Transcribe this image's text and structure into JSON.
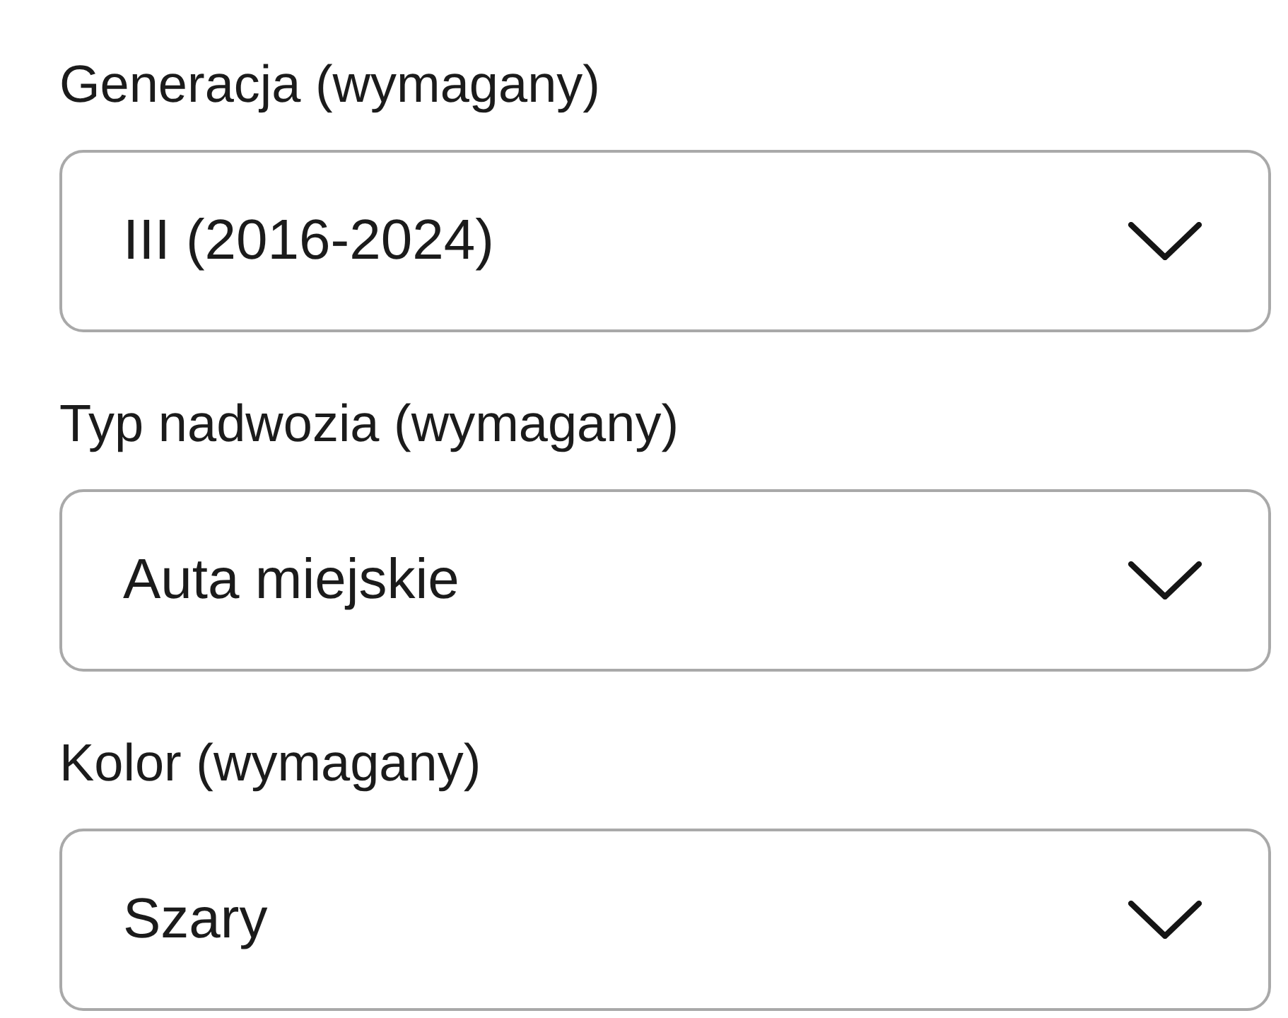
{
  "fields": [
    {
      "label": "Generacja (wymagany)",
      "value": "III (2016-2024)"
    },
    {
      "label": "Typ nadwozia (wymagany)",
      "value": "Auta miejskie"
    },
    {
      "label": "Kolor (wymagany)",
      "value": "Szary"
    }
  ]
}
